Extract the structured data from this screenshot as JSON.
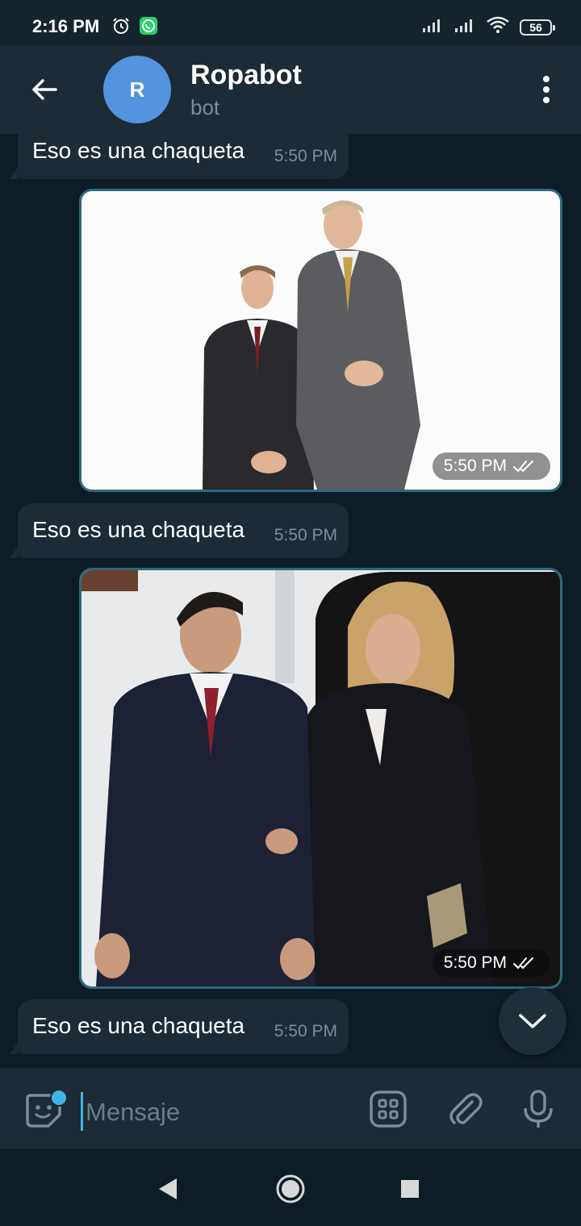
{
  "status_bar": {
    "time": "2:16 PM",
    "battery": "56",
    "icons": [
      "alarm-icon",
      "whatsapp-icon",
      "signal-icon",
      "signal-icon",
      "wifi-icon",
      "battery-icon"
    ]
  },
  "header": {
    "avatar_letter": "R",
    "avatar_color": "#5294de",
    "title": "Ropabot",
    "subtitle": "bot"
  },
  "messages": [
    {
      "type": "text",
      "direction": "incoming",
      "text": "Eso es una chaqueta",
      "time": "5:50 PM"
    },
    {
      "type": "photo",
      "direction": "outgoing",
      "time": "5:50 PM",
      "status": "read-double-check"
    },
    {
      "type": "text",
      "direction": "incoming",
      "text": "Eso es una chaqueta",
      "time": "5:50 PM"
    },
    {
      "type": "photo",
      "direction": "outgoing",
      "time": "5:50 PM",
      "status": "read-double-check"
    },
    {
      "type": "text",
      "direction": "incoming",
      "text": "Eso es una chaqueta",
      "time": "5:50 PM"
    }
  ],
  "composer": {
    "placeholder": "Mensaje",
    "accent": "#3fb4e8"
  },
  "colors": {
    "background": "#0e1c25",
    "bar": "#1c2b36",
    "bubble_incoming": "#1d2b36",
    "photo_border": "#2c6a7e"
  }
}
